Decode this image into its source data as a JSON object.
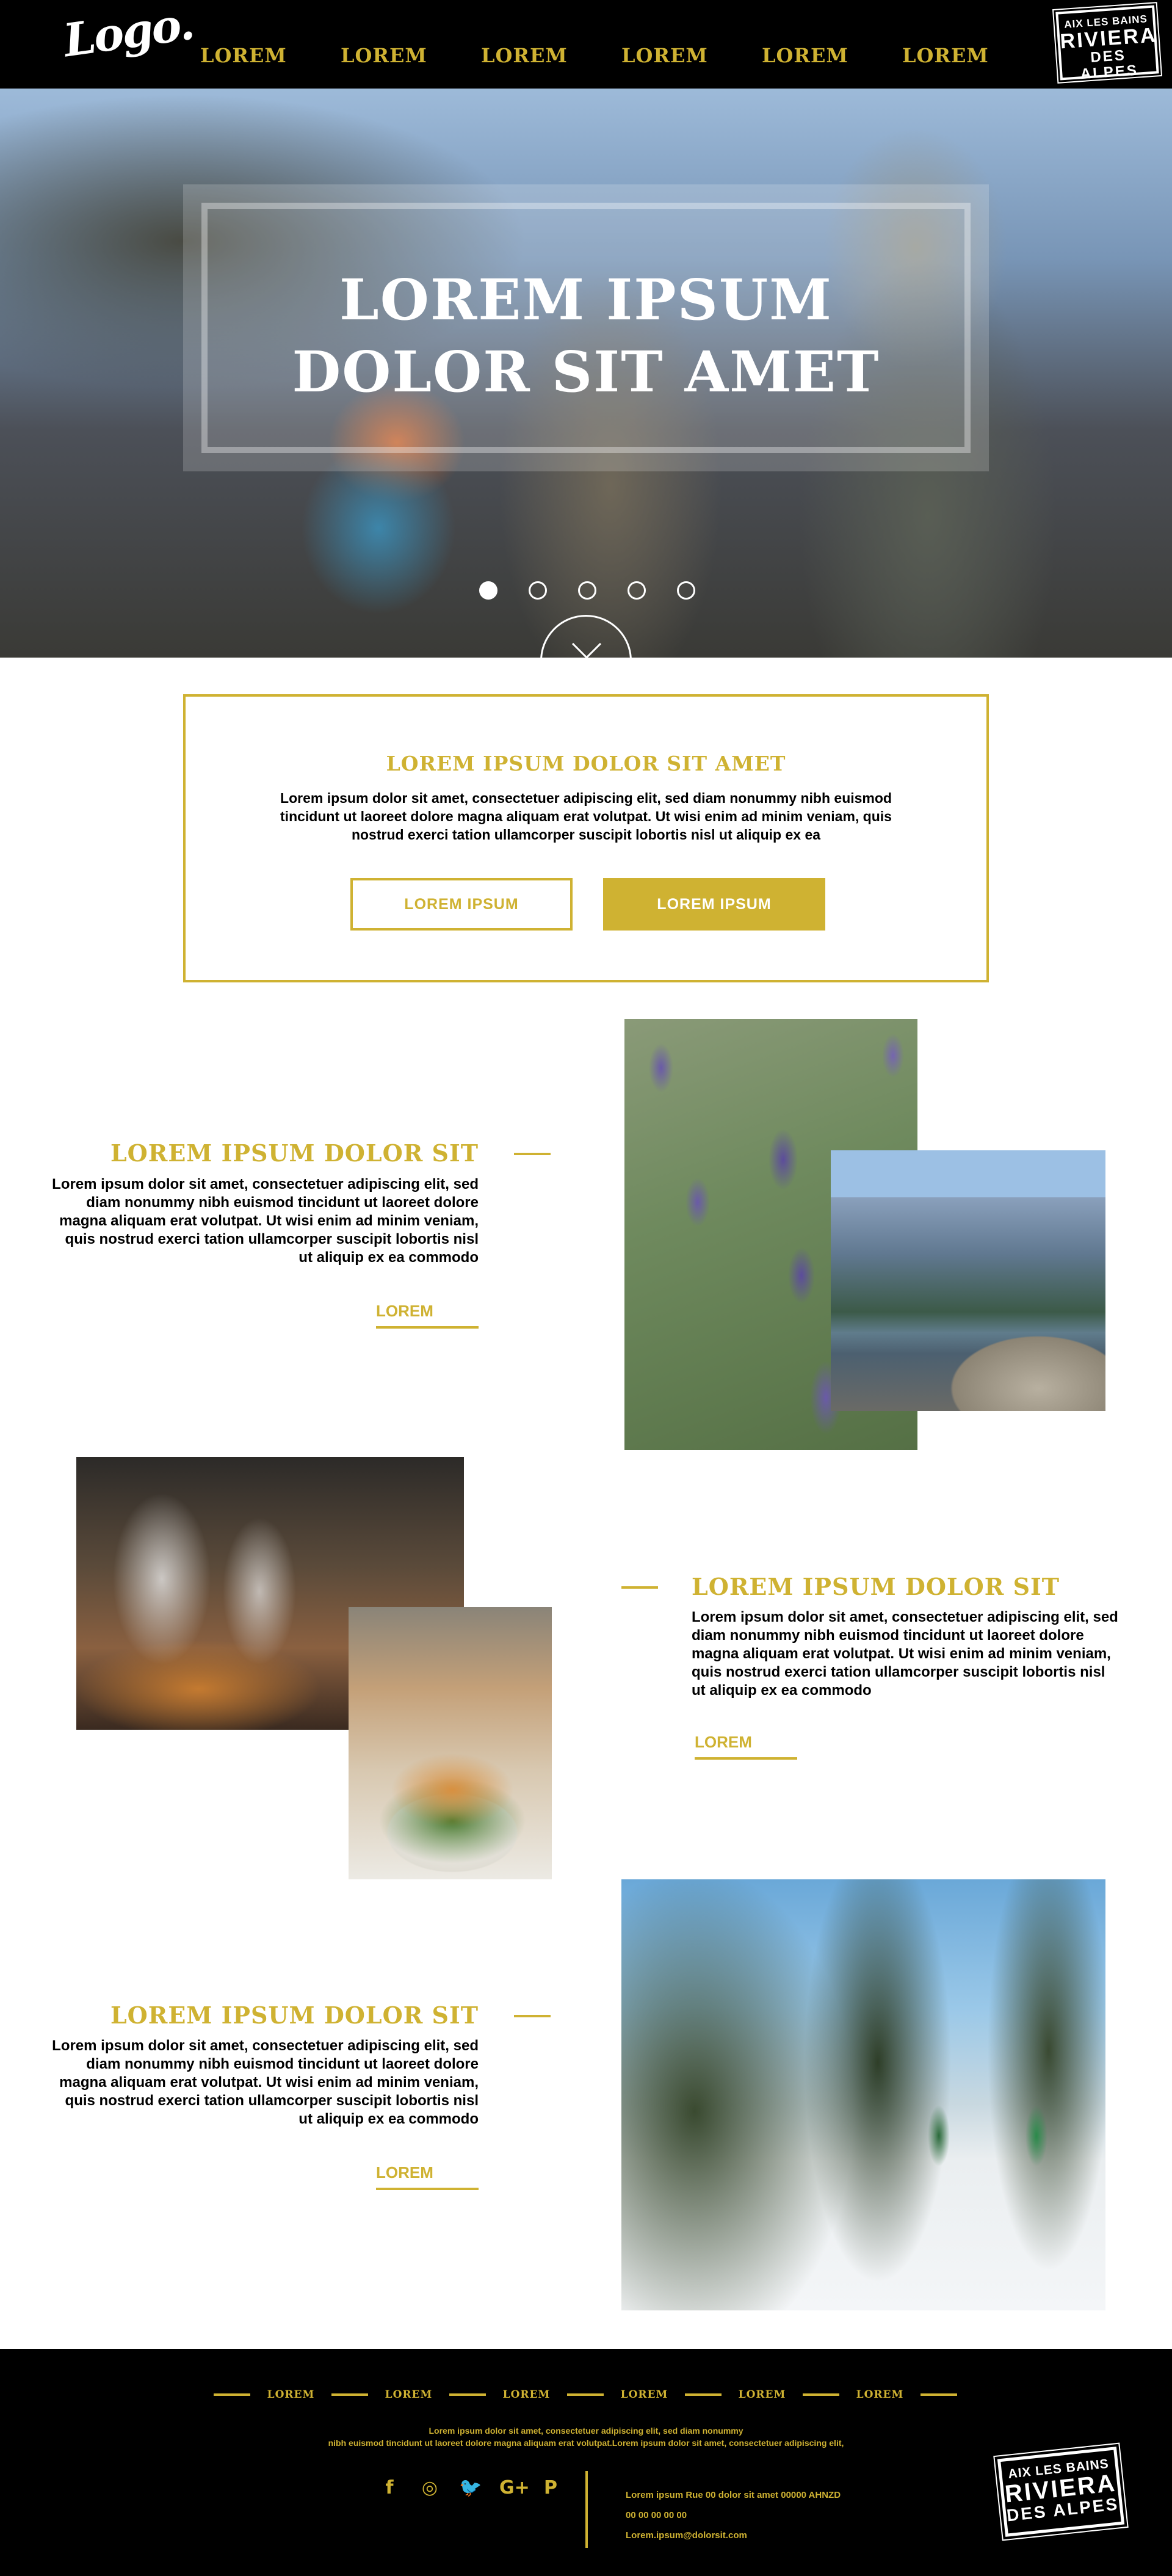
{
  "nav": {
    "logo": "Logo.",
    "items": [
      "LOREM",
      "LOREM",
      "LOREM",
      "LOREM",
      "LOREM",
      "LOREM"
    ],
    "active_index": 0,
    "badge": {
      "line1": "AIX LES BAINS",
      "line2": "RIVIERA",
      "line3": "DES ALPES"
    }
  },
  "hero": {
    "title_line1": "LOREM IPSUM",
    "title_line2": "DOLOR SIT AMET",
    "slides": 5,
    "active_slide": 0,
    "scroll_icon": "chevron-down-icon"
  },
  "intro": {
    "title": "LOREM IPSUM DOLOR SIT AMET",
    "text": "Lorem ipsum dolor sit amet, consectetuer adipiscing elit, sed diam nonummy nibh euismod tincidunt ut laoreet dolore magna aliquam erat volutpat. Ut wisi enim ad minim veniam, quis nostrud exerci tation ullamcorper suscipit lobortis nisl ut aliquip ex ea",
    "button_outline": "LOREM IPSUM",
    "button_solid": "LOREM IPSUM"
  },
  "sections": [
    {
      "title": "LOREM IPSUM DOLOR SIT",
      "text": "Lorem ipsum dolor sit amet, consectetuer adipiscing elit, sed diam nonummy nibh euismod tincidunt ut laoreet dolore magna aliquam erat volutpat. Ut wisi enim ad minim veniam, quis nostrud exerci tation ullamcorper suscipit lobortis nisl ut aliquip ex ea commodo",
      "link": "LOREM"
    },
    {
      "title": "LOREM IPSUM DOLOR SIT",
      "text": "Lorem ipsum dolor sit amet, consectetuer adipiscing elit, sed diam nonummy nibh euismod tincidunt ut laoreet dolore magna aliquam erat volutpat. Ut wisi enim ad minim veniam, quis nostrud exerci tation ullamcorper suscipit lobortis nisl ut aliquip ex ea commodo",
      "link": "LOREM"
    },
    {
      "title": "LOREM IPSUM DOLOR SIT",
      "text": "Lorem ipsum dolor sit amet, consectetuer adipiscing elit, sed diam nonummy nibh euismod tincidunt ut laoreet dolore magna aliquam erat volutpat. Ut wisi enim ad minim veniam, quis nostrud exerci tation ullamcorper suscipit lobortis nisl ut aliquip ex ea commodo",
      "link": "LOREM"
    }
  ],
  "footer": {
    "menu": [
      "LOREM",
      "LOREM",
      "LOREM",
      "LOREM",
      "LOREM",
      "LOREM"
    ],
    "text_line1": "Lorem ipsum dolor sit amet, consectetuer adipiscing elit, sed diam nonummy",
    "text_line2": "nibh euismod tincidunt ut laoreet dolore magna aliquam erat volutpat.Lorem ipsum dolor sit amet, consectetuer adipiscing elit,",
    "social": {
      "facebook": "f",
      "instagram": "◎",
      "twitter": "🐦",
      "googleplus": "G+",
      "pinterest": "P"
    },
    "address": "Lorem ipsum Rue 00 dolor sit amet 00000 AHNZD",
    "phone": "00 00 00 00 00",
    "email": "Lorem.ipsum@dolorsit.com",
    "badge": {
      "line1": "AIX LES BAINS",
      "line2": "RIVIERA",
      "line3": "DES ALPES"
    }
  },
  "colors": {
    "accent": "#cfb232",
    "background_dark": "#000000",
    "text": "#000000"
  }
}
